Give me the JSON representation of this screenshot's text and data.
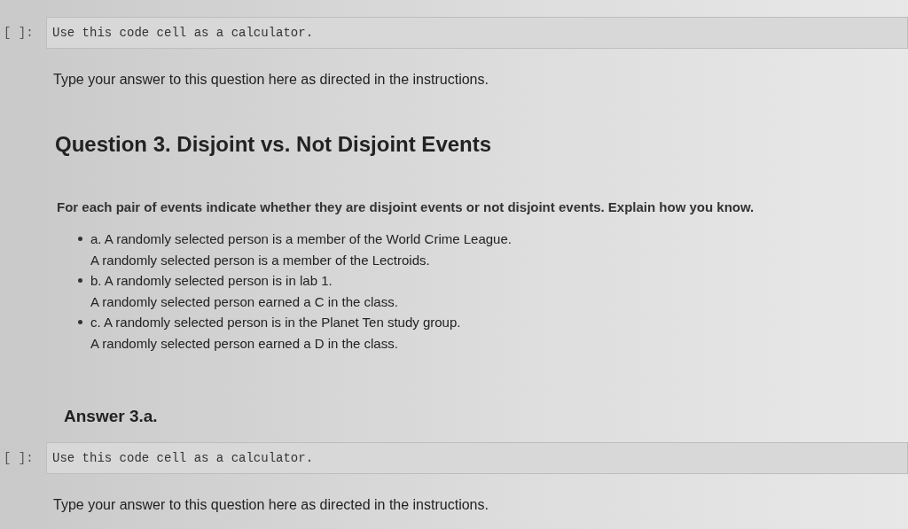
{
  "cells": [
    {
      "kind": "code",
      "prompt": "[ ]:",
      "source": "Use this code cell as a calculator."
    },
    {
      "kind": "text",
      "text": "Type your answer to this question here as directed in the instructions."
    },
    {
      "kind": "title",
      "text": "Question 3. Disjoint vs. Not Disjoint Events"
    },
    {
      "kind": "instructions",
      "text": "For each pair of events indicate whether they are disjoint events or not disjoint events. Explain how you know.",
      "items": [
        {
          "lines": [
            "a. A randomly selected person is a member of the World Crime League.",
            "A randomly selected person is a member of the Lectroids."
          ]
        },
        {
          "lines": [
            "b. A randomly selected person is in lab 1.",
            "A randomly selected person earned a C in the class."
          ]
        },
        {
          "lines": [
            "c. A randomly selected person is in the Planet Ten study group.",
            "A randomly selected person earned a D in the class."
          ]
        }
      ]
    },
    {
      "kind": "subtitle",
      "text": "Answer 3.a."
    },
    {
      "kind": "code",
      "prompt": "[ ]:",
      "source": "Use this code cell as a calculator."
    },
    {
      "kind": "text",
      "text": "Type your answer to this question here as directed in the instructions."
    }
  ]
}
